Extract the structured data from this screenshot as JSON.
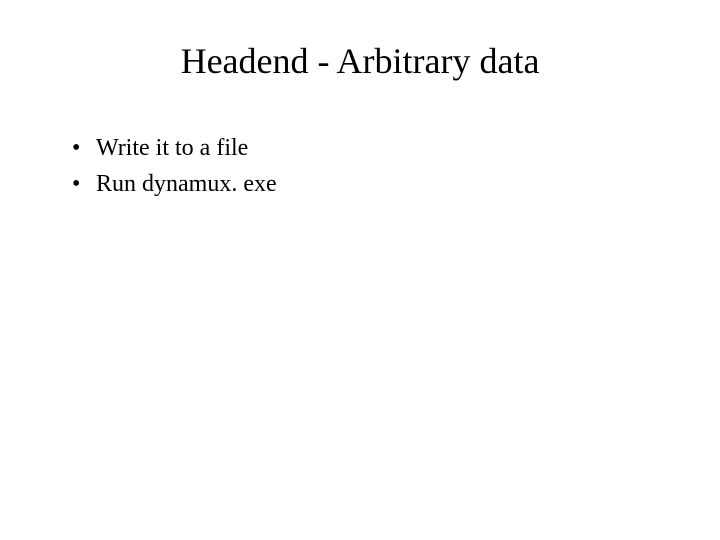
{
  "slide": {
    "title": "Headend - Arbitrary data",
    "bullets": [
      "Write it to a file",
      "Run dynamux. exe"
    ]
  }
}
